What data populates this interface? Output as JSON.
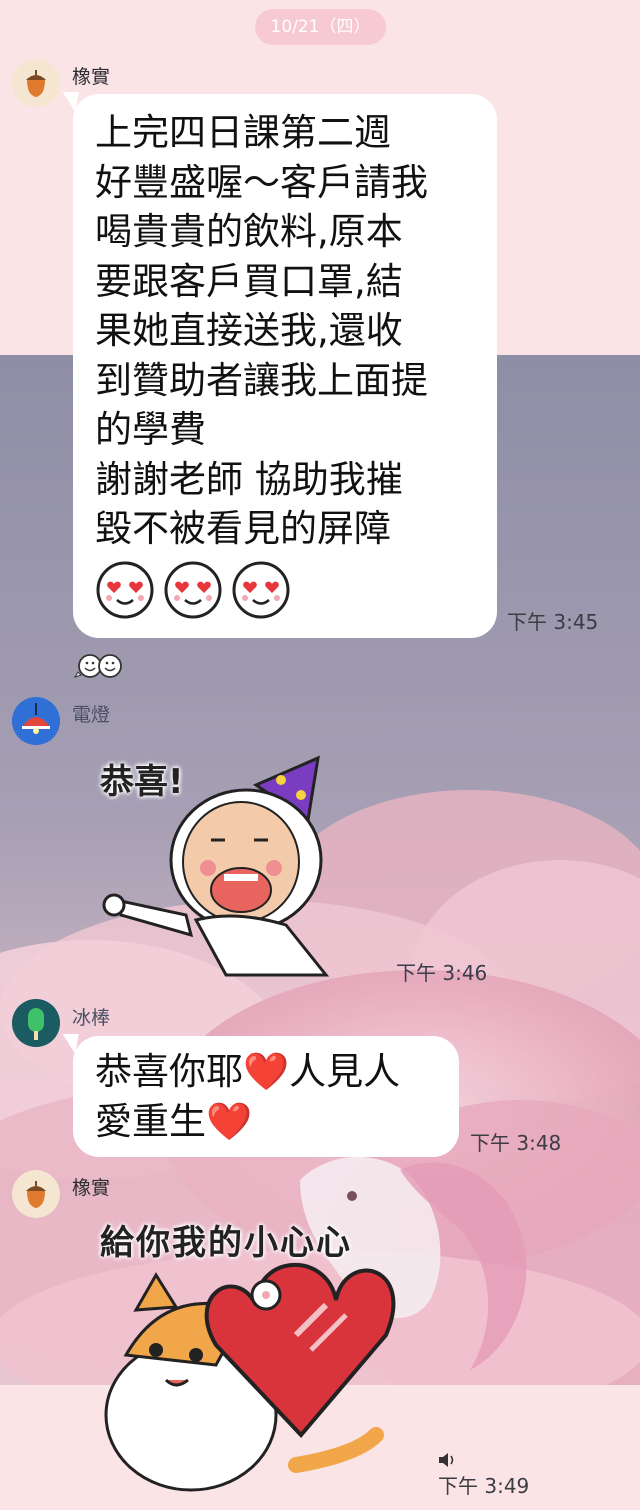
{
  "date_separator": "10/21（四）",
  "messages": [
    {
      "sender": "橡實",
      "avatar_icon": "acorn-icon",
      "lines": [
        "上完四日課第二週",
        "好豐盛喔～客戶請我",
        "喝貴貴的飲料,原本",
        "要跟客戶買口罩,結",
        "果她直接送我,還收",
        "到贊助者讓我上面提",
        "的學費",
        "謝謝老師 協助我摧",
        "毀不被看見的屏障"
      ],
      "emoji": [
        "heart-eyes-face-icon",
        "heart-eyes-face-icon",
        "heart-eyes-face-icon"
      ],
      "time": "下午 3:45",
      "reaction_icon": "smiling-faces-reaction-icon"
    },
    {
      "sender": "電燈",
      "avatar_icon": "ceiling-lamp-icon",
      "sticker_text": "恭喜!",
      "sticker_icon": "party-hat-character-sticker",
      "time": "下午 3:46"
    },
    {
      "sender": "冰棒",
      "avatar_icon": "popsicle-icon",
      "lines": [
        "恭喜你耶❤️人見人",
        "愛重生❤️"
      ],
      "time": "下午 3:48"
    },
    {
      "sender": "橡實",
      "avatar_icon": "acorn-icon",
      "sticker_text": "給你我的小心心",
      "sticker_icon": "cat-holding-heart-sticker",
      "sound_icon": "speaker-icon",
      "time": "下午 3:49"
    }
  ],
  "colors": {
    "top_background": "#fbe4e6",
    "mid_background": "#8f8fa7",
    "bubble": "#ffffff",
    "date_pill": "#f7c9d2"
  }
}
